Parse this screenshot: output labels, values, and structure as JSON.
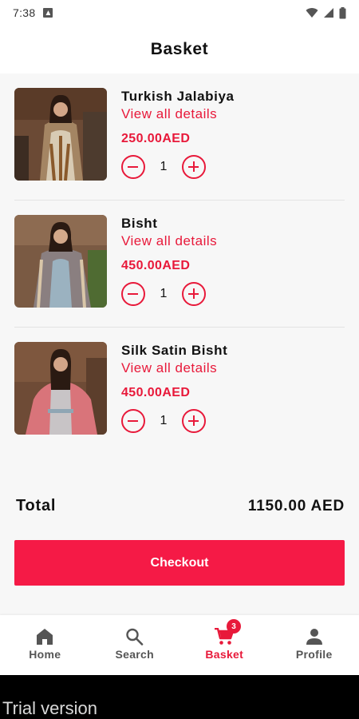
{
  "status_bar": {
    "time": "7:38"
  },
  "header": {
    "title": "Basket"
  },
  "cart": {
    "items": [
      {
        "name": "Turkish Jalabiya",
        "details_link": "View all details",
        "price": "250.00AED",
        "quantity": "1"
      },
      {
        "name": "Bisht",
        "details_link": "View all details",
        "price": "450.00AED",
        "quantity": "1"
      },
      {
        "name": "Silk Satin Bisht",
        "details_link": "View all details",
        "price": "450.00AED",
        "quantity": "1"
      }
    ],
    "total_label": "Total",
    "total_value": "1150.00 AED",
    "checkout_label": "Checkout"
  },
  "bottom_nav": {
    "items": [
      {
        "label": "Home",
        "icon": "home-icon",
        "active": false
      },
      {
        "label": "Search",
        "icon": "search-icon",
        "active": false
      },
      {
        "label": "Basket",
        "icon": "cart-icon",
        "active": true,
        "badge": "3"
      },
      {
        "label": "Profile",
        "icon": "person-icon",
        "active": false
      }
    ]
  },
  "watermark": "Trial version",
  "colors": {
    "accent": "#e8193a",
    "checkout": "#f51a46",
    "nav_inactive": "#555555"
  }
}
